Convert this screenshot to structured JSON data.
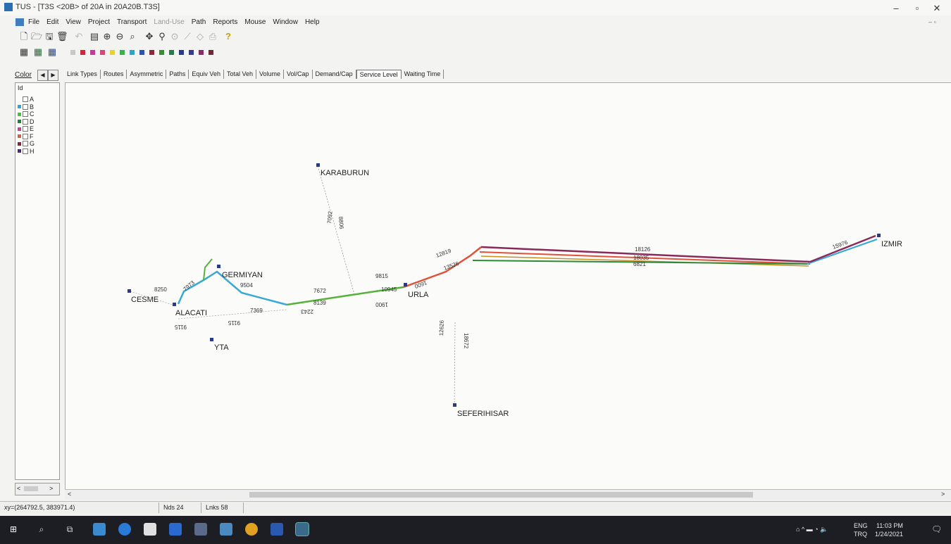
{
  "window": {
    "title": "TUS - [T3S <20B> of 20A in 20A20B.T3S]",
    "minimize_label": "–",
    "maximize_label": "▫",
    "close_label": "✕",
    "restore_doc_label": "– ▫"
  },
  "menu": [
    "File",
    "Edit",
    "View",
    "Project",
    "Transport",
    "Land-Use",
    "Path",
    "Reports",
    "Mouse",
    "Window",
    "Help"
  ],
  "toolbar_help_label": "?",
  "swatch_colors": [
    "#c8c8c8",
    "#cc2a3a",
    "#c23c9c",
    "#d24a7a",
    "#e4d23a",
    "#3cb04a",
    "#2fa4c8",
    "#2a54b0",
    "#8a2a3a",
    "#3a8a3a",
    "#2a7a4a",
    "#2a3a8a",
    "#3a3a8a",
    "#8a2a6a",
    "#6a2a3a"
  ],
  "tabbar": {
    "color_label": "Color",
    "left_arrow": "◀",
    "right_arrow": "▶",
    "tabs": [
      "Link Types",
      "Routes",
      "Asymmetric",
      "Paths",
      "Equiv Veh",
      "Total Veh",
      "Volume",
      "Vol/Cap",
      "Demand/Cap",
      "Service Level",
      "Waiting Time"
    ],
    "active_tab": "Service Level"
  },
  "legend": {
    "header": "Id",
    "items": [
      {
        "label": "A",
        "color": ""
      },
      {
        "label": "B",
        "color": "#2fa4d8"
      },
      {
        "label": "C",
        "color": "#56b84a"
      },
      {
        "label": "D",
        "color": "#2f7a3a"
      },
      {
        "label": "E",
        "color": "#c83ca0"
      },
      {
        "label": "F",
        "color": "#e05a4a"
      },
      {
        "label": "G",
        "color": "#7a2a3a"
      },
      {
        "label": "H",
        "color": "#4a2a6a"
      }
    ]
  },
  "map": {
    "nodes": {
      "karaburun": "KARABURUN",
      "germiyan": "GERMIYAN",
      "cesme": "CESME",
      "alacati": "ALACATI",
      "yta": "YTA",
      "urla": "URLA",
      "seferihisar": "SEFERIHISAR",
      "izmir": "IZMIR"
    },
    "link_labels": {
      "n_18126": "18126",
      "n_18035": "18035",
      "n_6821": "6821",
      "n_15976": "15976",
      "n_12819": "12819",
      "n_9815": "9815",
      "n_10945": "10945",
      "n_1900": "1900",
      "n_7672": "7672",
      "n_8139": "8139",
      "n_2243": "2243",
      "n_9504": "9504",
      "n_7369": "7369",
      "n_9115a": "9115",
      "n_9115b": "9115",
      "n_7973": "7973",
      "n_8250": "8250",
      "n_7092": "7092",
      "n_8806": "8806",
      "n_12626": "12626",
      "n_18672": "18672",
      "n_1600": "1600",
      "n_13526": "13526"
    }
  },
  "status": {
    "coords": "xy=(264792.5, 383971.4)",
    "nodes": "Nds 24",
    "links": "Lnks 58"
  },
  "taskbar": {
    "lang_top": "ENG",
    "lang_bottom": "TRQ",
    "time": "11:03 PM",
    "date": "1/24/2021"
  }
}
